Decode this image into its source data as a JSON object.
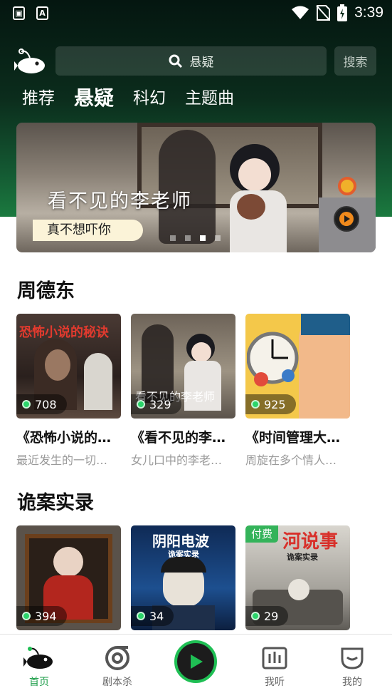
{
  "status_bar": {
    "time": "3:39"
  },
  "header": {
    "search_placeholder": "悬疑",
    "search_button": "搜索"
  },
  "tabs": [
    {
      "label": "推荐",
      "active": false
    },
    {
      "label": "悬疑",
      "active": true
    },
    {
      "label": "科幻",
      "active": false
    },
    {
      "label": "主题曲",
      "active": false
    }
  ],
  "banner": {
    "title": "看不见的李老师",
    "subtitle": "真不想吓你",
    "page_count": 4,
    "active_index": 2
  },
  "sections": [
    {
      "title": "周德东",
      "items": [
        {
          "count": "708",
          "title": "《恐怖小说的…",
          "desc": "最近发生的一切…",
          "cover_text": "恐怖小说的秘诀",
          "paid": false
        },
        {
          "count": "329",
          "title": "《看不见的李…",
          "desc": "女儿口中的李老…",
          "cover_text": "看不见的李老师",
          "paid": false
        },
        {
          "count": "925",
          "title": "《时间管理大…",
          "desc": "周旋在多个情人…",
          "cover_text": "",
          "paid": false
        }
      ]
    },
    {
      "title": "诡案实录",
      "items": [
        {
          "count": "394",
          "cover_text": "",
          "paid": false
        },
        {
          "count": "34",
          "cover_text": "阴阳电波",
          "paid": false,
          "sub_text": "诡案实录"
        },
        {
          "count": "29",
          "cover_text": "河说事",
          "paid": true,
          "badge": "付费",
          "sub_text": "诡案实录"
        }
      ]
    }
  ],
  "bottom_nav": [
    {
      "label": "首页",
      "icon": "fish-logo-icon",
      "active": true
    },
    {
      "label": "剧本杀",
      "icon": "disc-icon",
      "active": false
    },
    {
      "label": "",
      "icon": "play-icon",
      "active": false
    },
    {
      "label": "我听",
      "icon": "equalizer-icon",
      "active": false
    },
    {
      "label": "我的",
      "icon": "profile-icon",
      "active": false
    }
  ],
  "colors": {
    "accent": "#1fbf54",
    "header_dark": "#0b2c1c",
    "paid_badge": "#34b35a"
  }
}
